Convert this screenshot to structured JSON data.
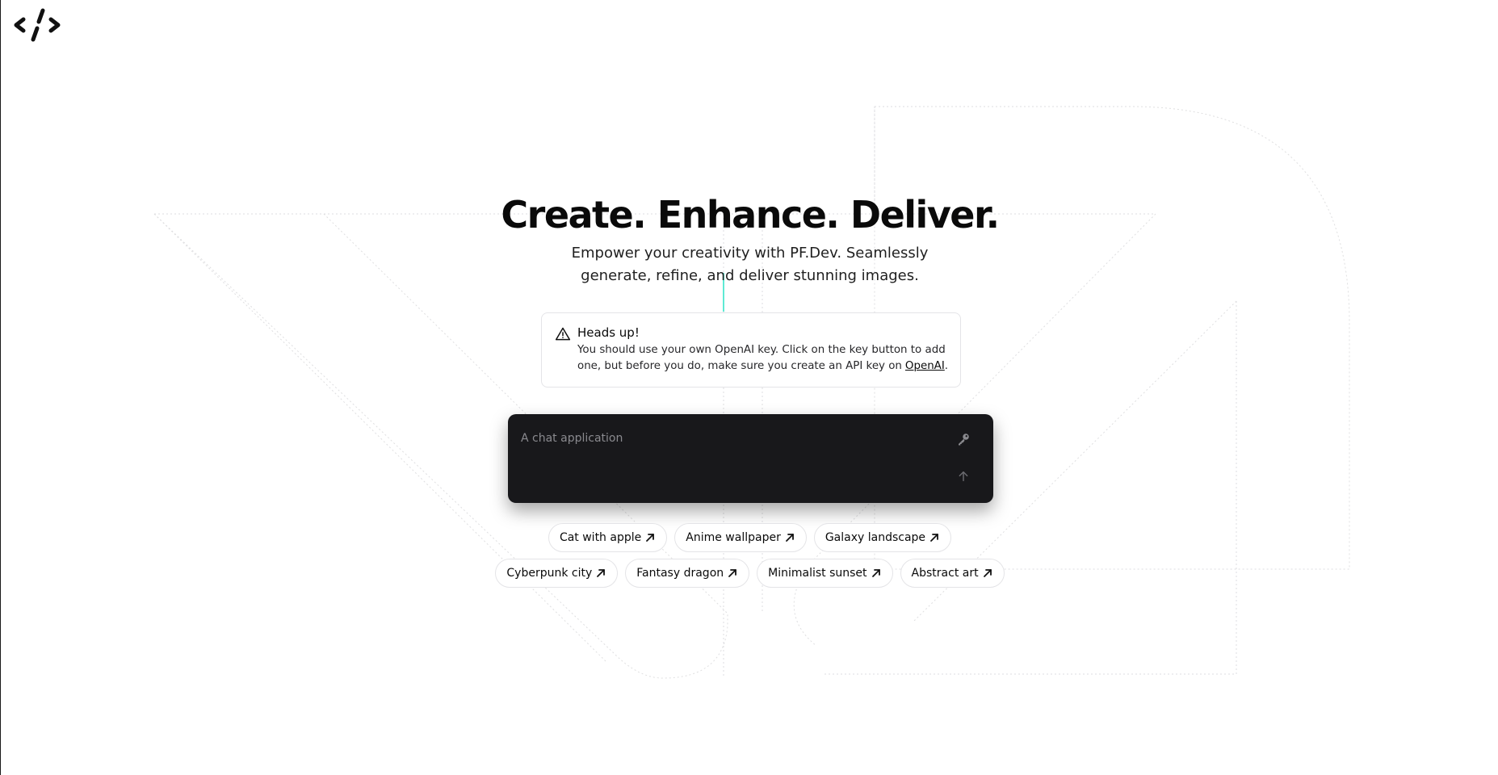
{
  "brand": {
    "logo_icon": "code-slash-logo-icon"
  },
  "hero": {
    "title": "Create. Enhance. Deliver.",
    "subtitle": "Empower your creativity with PF.Dev. Seamlessly generate, refine, and deliver stunning images."
  },
  "alert": {
    "icon": "warning-triangle-icon",
    "title": "Heads up!",
    "text": "You should use your own OpenAI key. Click on the key button to add one, but before you do, make sure you create an API key on",
    "link_label": "OpenAI",
    "suffix": "."
  },
  "prompt": {
    "placeholder": "A chat application",
    "value": "",
    "key_icon": "key-icon",
    "send_icon": "arrow-up-icon"
  },
  "suggestions": {
    "rows": [
      [
        "Cat with apple",
        "Anime wallpaper",
        "Galaxy landscape"
      ],
      [
        "Cyberpunk city",
        "Fantasy dragon",
        "Minimalist sunset",
        "Abstract art"
      ]
    ],
    "chip_icon": "arrow-up-right-icon"
  },
  "colors": {
    "background": "#ffffff",
    "prompt_bg": "#18181b",
    "accent_line": "#5eead4",
    "border": "#e4e4e7"
  }
}
